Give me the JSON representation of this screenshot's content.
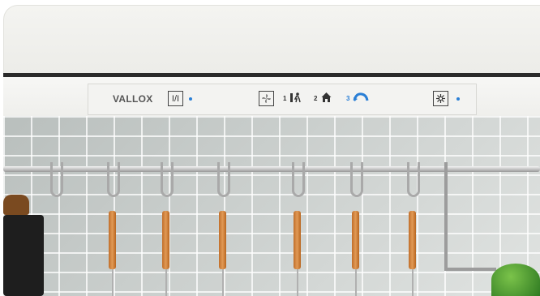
{
  "panel": {
    "brand": "VALLOX",
    "power_symbol": "I/I",
    "speed_1_label": "1",
    "speed_2_label": "2",
    "speed_3_label": "3",
    "accent_color": "#2a7fd6",
    "icons": [
      "power-icon",
      "fan-icon",
      "away-person-icon",
      "home-icon",
      "boost-icon",
      "light-icon"
    ]
  }
}
